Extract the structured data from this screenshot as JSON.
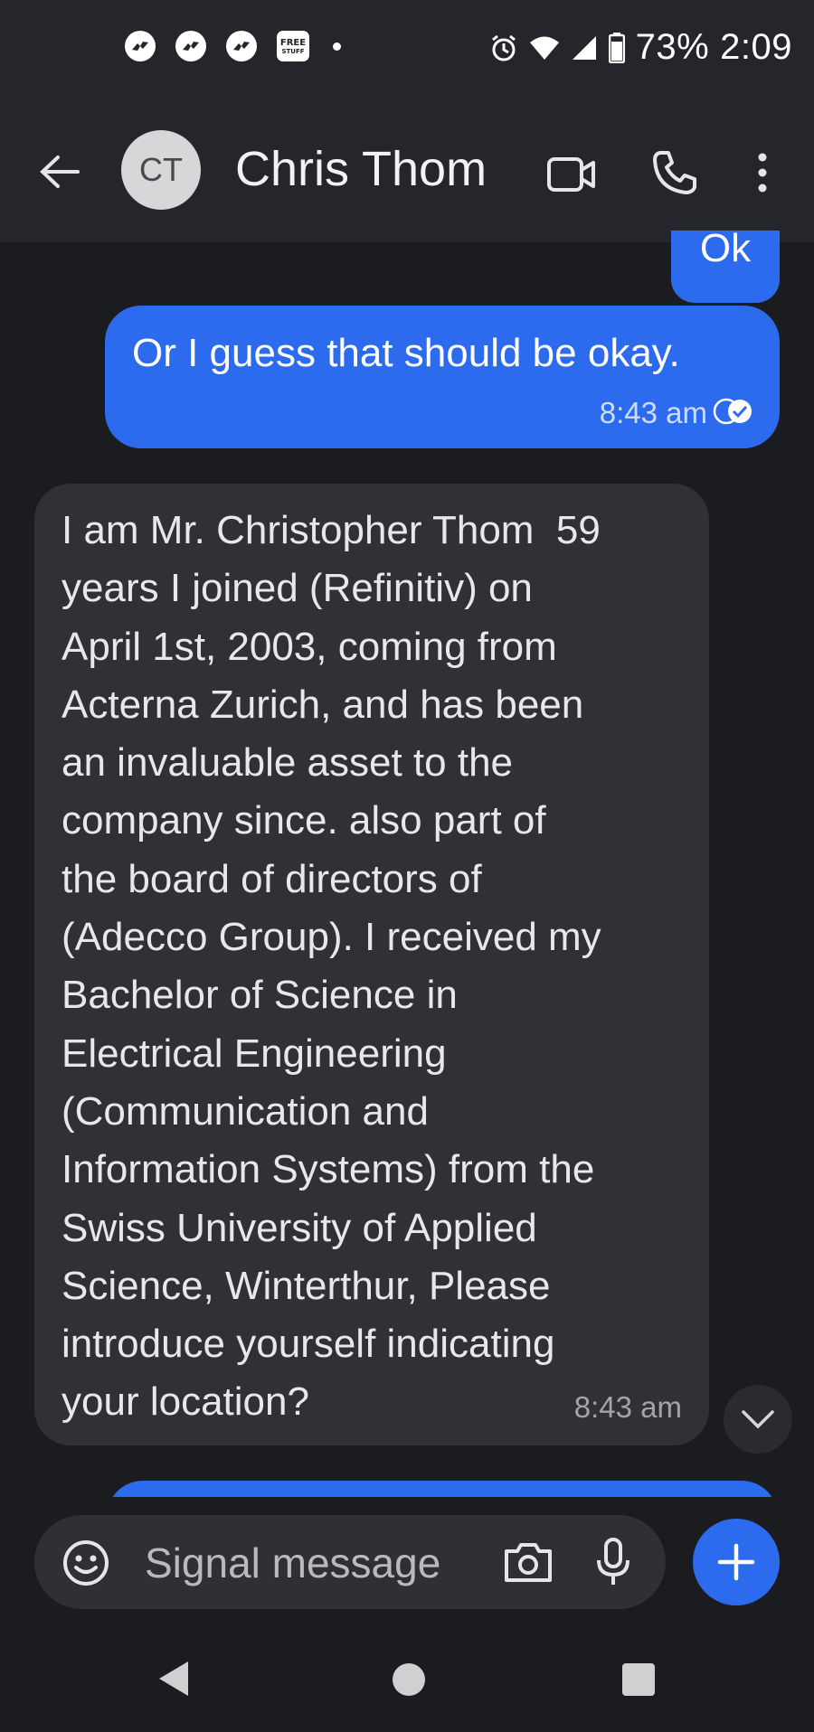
{
  "status_bar": {
    "free_badge_line1": "FREE",
    "free_badge_line2": "STUFF",
    "battery": "73%",
    "time": "2:09"
  },
  "header": {
    "avatar_initials": "CT",
    "contact_name": "Chris Thom"
  },
  "messages": [
    {
      "direction": "outgoing",
      "text": "Ok"
    },
    {
      "direction": "outgoing",
      "text": "Or I guess that should be okay.",
      "time": "8:43 am",
      "status": "read"
    },
    {
      "direction": "incoming",
      "text": "I am Mr. Christopher Thom  59\nyears I joined (Refinitiv) on\nApril 1st, 2003, coming from\nActerna Zurich, and has been\nan invaluable asset to the\ncompany since. also part of\nthe board of directors of\n(Adecco Group). I received my\nBachelor of Science in\nElectrical Engineering\n(Communication and\nInformation Systems) from the\nSwiss University of Applied\nScience, Winterthur, Please\nintroduce yourself indicating\nyour location?",
      "time": "8:43 am"
    }
  ],
  "composer": {
    "placeholder": "Signal message"
  },
  "colors": {
    "accent": "#2c6bed",
    "background": "#1b1c1f",
    "incoming_bubble": "#303134"
  }
}
